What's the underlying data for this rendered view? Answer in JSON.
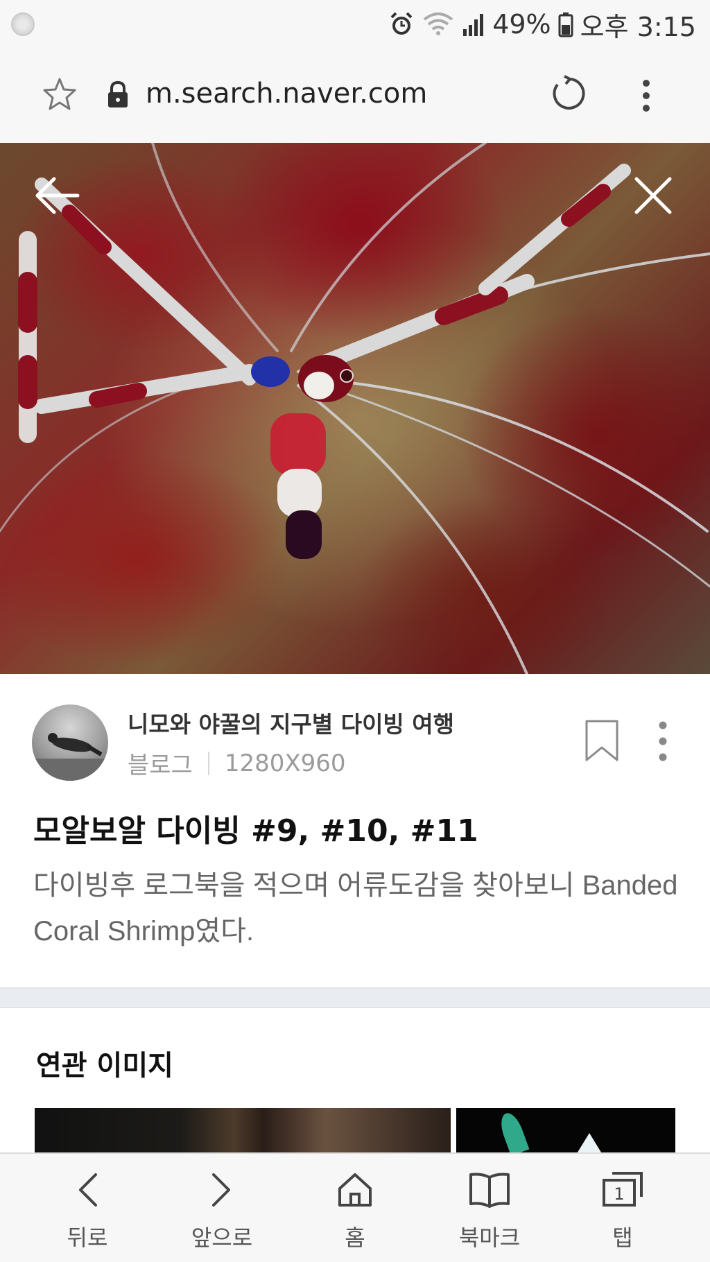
{
  "status_bar": {
    "battery": "49%",
    "time": "오후 3:15",
    "icons": [
      "alarm-icon",
      "wifi-icon",
      "signal-icon",
      "battery-icon"
    ]
  },
  "address_bar": {
    "url": "m.search.naver.com",
    "icons": [
      "star-icon",
      "lock-icon",
      "reload-icon",
      "more-vert-icon"
    ]
  },
  "viewer": {
    "icons": [
      "arrow-left-icon",
      "close-icon"
    ]
  },
  "source": {
    "name": "니모와 야꿀의 지구별 다이빙 여행",
    "type": "블로그",
    "dimensions": "1280X960"
  },
  "post": {
    "title": "모알보알 다이빙 #9, #10, #11",
    "description": "다이빙후 로그북을 적으며 어류도감을 찾아보니 Banded Coral Shrimp였다."
  },
  "related": {
    "title": "연관 이미지"
  },
  "bottom_nav": {
    "items": [
      {
        "label": "뒤로",
        "icon": "chevron-left-icon"
      },
      {
        "label": "앞으로",
        "icon": "chevron-right-icon"
      },
      {
        "label": "홈",
        "icon": "home-icon"
      },
      {
        "label": "북마크",
        "icon": "book-icon"
      },
      {
        "label": "탭",
        "icon": "tabs-icon",
        "badge": "1"
      }
    ]
  },
  "colors": {
    "chrome_bg": "#f7f7f7",
    "divider": "#e9edf1",
    "text_primary": "#111111",
    "text_secondary": "#666666",
    "text_meta": "#9a9a9a"
  }
}
